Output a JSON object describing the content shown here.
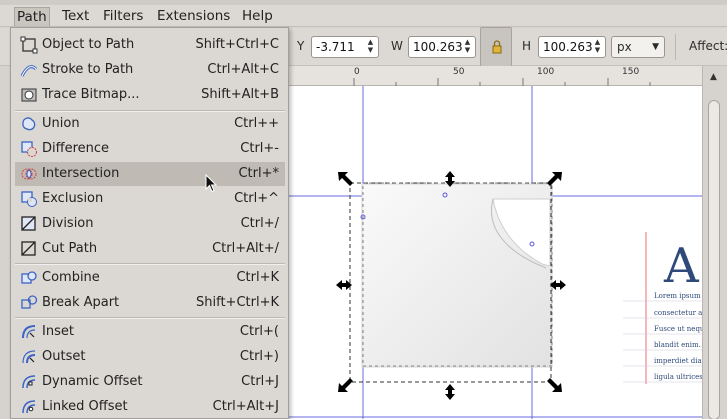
{
  "menubar": {
    "items": [
      {
        "label": "Path"
      },
      {
        "label": "Text"
      },
      {
        "label": "Filters"
      },
      {
        "label": "Extensions"
      },
      {
        "label": "Help"
      }
    ]
  },
  "toolbar": {
    "y_label": "Y",
    "y_value": "-3.711",
    "w_label": "W",
    "w_value": "100.263",
    "h_label": "H",
    "h_value": "100.263",
    "unit": "px",
    "affect_label": "Affect:"
  },
  "ruler": {
    "labels": [
      "0",
      "50",
      "100",
      "150"
    ]
  },
  "path_menu": {
    "groups": [
      [
        {
          "label": "Object to Path",
          "accel": "Shift+Ctrl+C",
          "icon": "object-to-path-icon"
        },
        {
          "label": "Stroke to Path",
          "accel": "Ctrl+Alt+C",
          "icon": "stroke-to-path-icon"
        },
        {
          "label": "Trace Bitmap...",
          "accel": "Shift+Alt+B",
          "icon": "trace-bitmap-icon"
        }
      ],
      [
        {
          "label": "Union",
          "accel": "Ctrl++",
          "icon": "union-icon"
        },
        {
          "label": "Difference",
          "accel": "Ctrl+-",
          "icon": "difference-icon"
        },
        {
          "label": "Intersection",
          "accel": "Ctrl+*",
          "icon": "intersection-icon",
          "highlighted": true
        },
        {
          "label": "Exclusion",
          "accel": "Ctrl+^",
          "icon": "exclusion-icon"
        },
        {
          "label": "Division",
          "accel": "Ctrl+/",
          "icon": "division-icon"
        },
        {
          "label": "Cut Path",
          "accel": "Ctrl+Alt+/",
          "icon": "cut-path-icon"
        }
      ],
      [
        {
          "label": "Combine",
          "accel": "Ctrl+K",
          "icon": "combine-icon"
        },
        {
          "label": "Break Apart",
          "accel": "Shift+Ctrl+K",
          "icon": "break-apart-icon"
        }
      ],
      [
        {
          "label": "Inset",
          "accel": "Ctrl+(",
          "icon": "inset-icon"
        },
        {
          "label": "Outset",
          "accel": "Ctrl+)",
          "icon": "outset-icon"
        },
        {
          "label": "Dynamic Offset",
          "accel": "Ctrl+J",
          "icon": "dynamic-offset-icon"
        },
        {
          "label": "Linked Offset",
          "accel": "Ctrl+Alt+J",
          "icon": "linked-offset-icon"
        }
      ]
    ]
  },
  "canvas_text": {
    "drop_cap": "A",
    "lines": [
      "Lorem ipsum d",
      "consectetur adi",
      "Fusce ut neque",
      "blandit enim. V",
      "imperdiet dian",
      "ligula ultrices r"
    ]
  },
  "colors": {
    "guide": "#5a5ad8",
    "accent_blue": "#2f5aa8",
    "menu_highlight": "#bfbab4"
  }
}
